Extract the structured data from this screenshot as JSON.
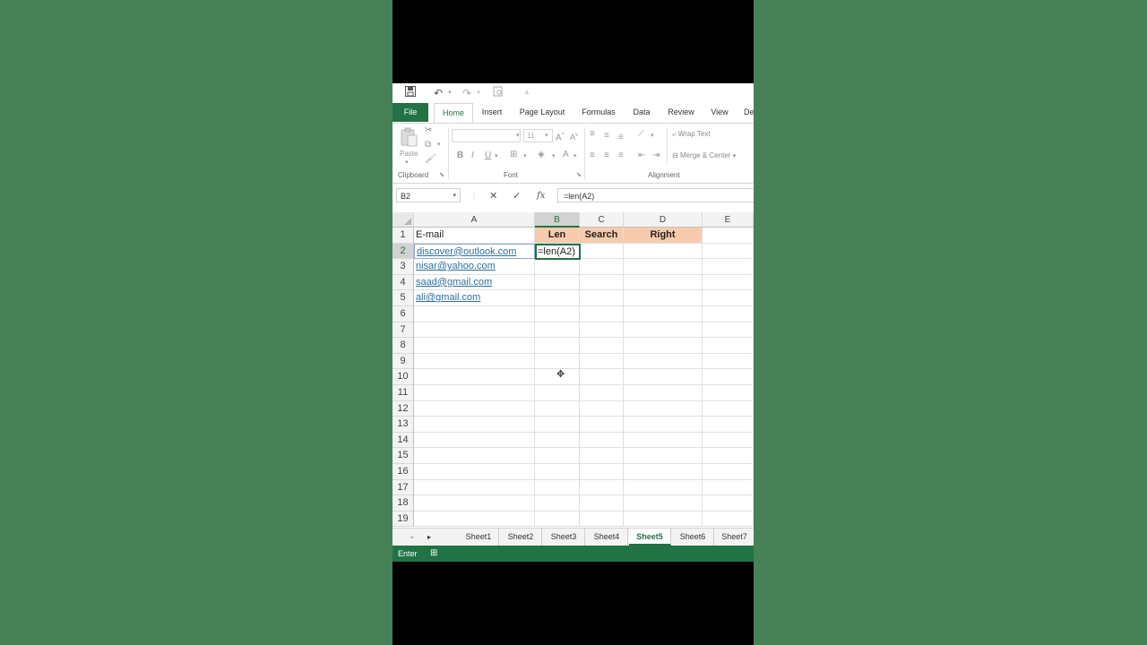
{
  "qat": {
    "save_icon": "save-icon",
    "undo_icon": "undo-icon",
    "redo_icon": "redo-icon",
    "print_preview_icon": "print-preview-icon",
    "customize_icon": "customize-qat-icon"
  },
  "ribbon_tabs": [
    "File",
    "Home",
    "Insert",
    "Page Layout",
    "Formulas",
    "Data",
    "Review",
    "View",
    "De"
  ],
  "ribbon": {
    "paste_label": "Paste",
    "font_size": "11",
    "bold": "B",
    "italic": "I",
    "underline": "U",
    "wrap_text": "Wrap Text",
    "merge_center": "Merge & Center",
    "groups": {
      "clipboard": "Clipboard",
      "font": "Font",
      "alignment": "Alignment"
    }
  },
  "formula_bar": {
    "name_box": "B2",
    "formula": "=len(A2)",
    "fx": "fx"
  },
  "columns": [
    "A",
    "B",
    "C",
    "D",
    "E"
  ],
  "rows": [
    "1",
    "2",
    "3",
    "4",
    "5",
    "6",
    "7",
    "8",
    "9",
    "10",
    "11",
    "12",
    "13",
    "14",
    "15",
    "16",
    "17",
    "18",
    "19"
  ],
  "headers": {
    "a1": "E-mail",
    "b1": "Len",
    "c1": "Search",
    "d1": "Right"
  },
  "emails": [
    "discover@outlook.com",
    "nisar@yahoo.com",
    "saad@gmail.com",
    "ali@gmail.com"
  ],
  "active_cell_value": "=len(A2)",
  "sheets": [
    "Sheet1",
    "Sheet2",
    "Sheet3",
    "Sheet4",
    "Sheet5",
    "Sheet6",
    "Sheet7"
  ],
  "active_sheet": "Sheet5",
  "status": {
    "mode": "Enter"
  },
  "colors": {
    "accent": "#217346",
    "header_fill": "#f8cbad",
    "background": "#478156",
    "link": "#2e6f9e"
  }
}
